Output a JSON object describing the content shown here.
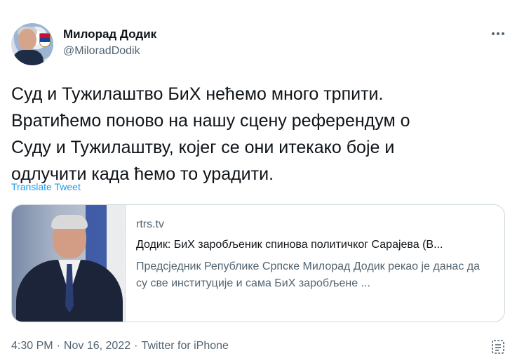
{
  "author": {
    "name": "Милорад Додик",
    "handle": "@MiloradDodik"
  },
  "more_icon": "more-horizontal-icon",
  "tweet_text": "Суд и Тужилаштво БиХ нећемо много трпити.\nВратићемо поново на нашу сцену референдум о\nСуду и Тужилаштву, којег се они итекако боје и\nодлучити када ћемо то урадити.",
  "translate_label": "Translate Tweet",
  "card": {
    "domain": "rtrs.tv",
    "title": "Додик: БиХ заробљеник спинова политичког Сарајева (В...",
    "description": "Предсједник Републике Српске Милорад Додик рекао је данас да су све институције и сама БиХ заробљене ..."
  },
  "meta": {
    "time": "4:30 PM",
    "date": "Nov 16, 2022",
    "source": "Twitter for iPhone",
    "separator": "·"
  },
  "colors": {
    "link": "#1d9bf0",
    "secondary_text": "#536471",
    "border": "#cfd9de"
  }
}
